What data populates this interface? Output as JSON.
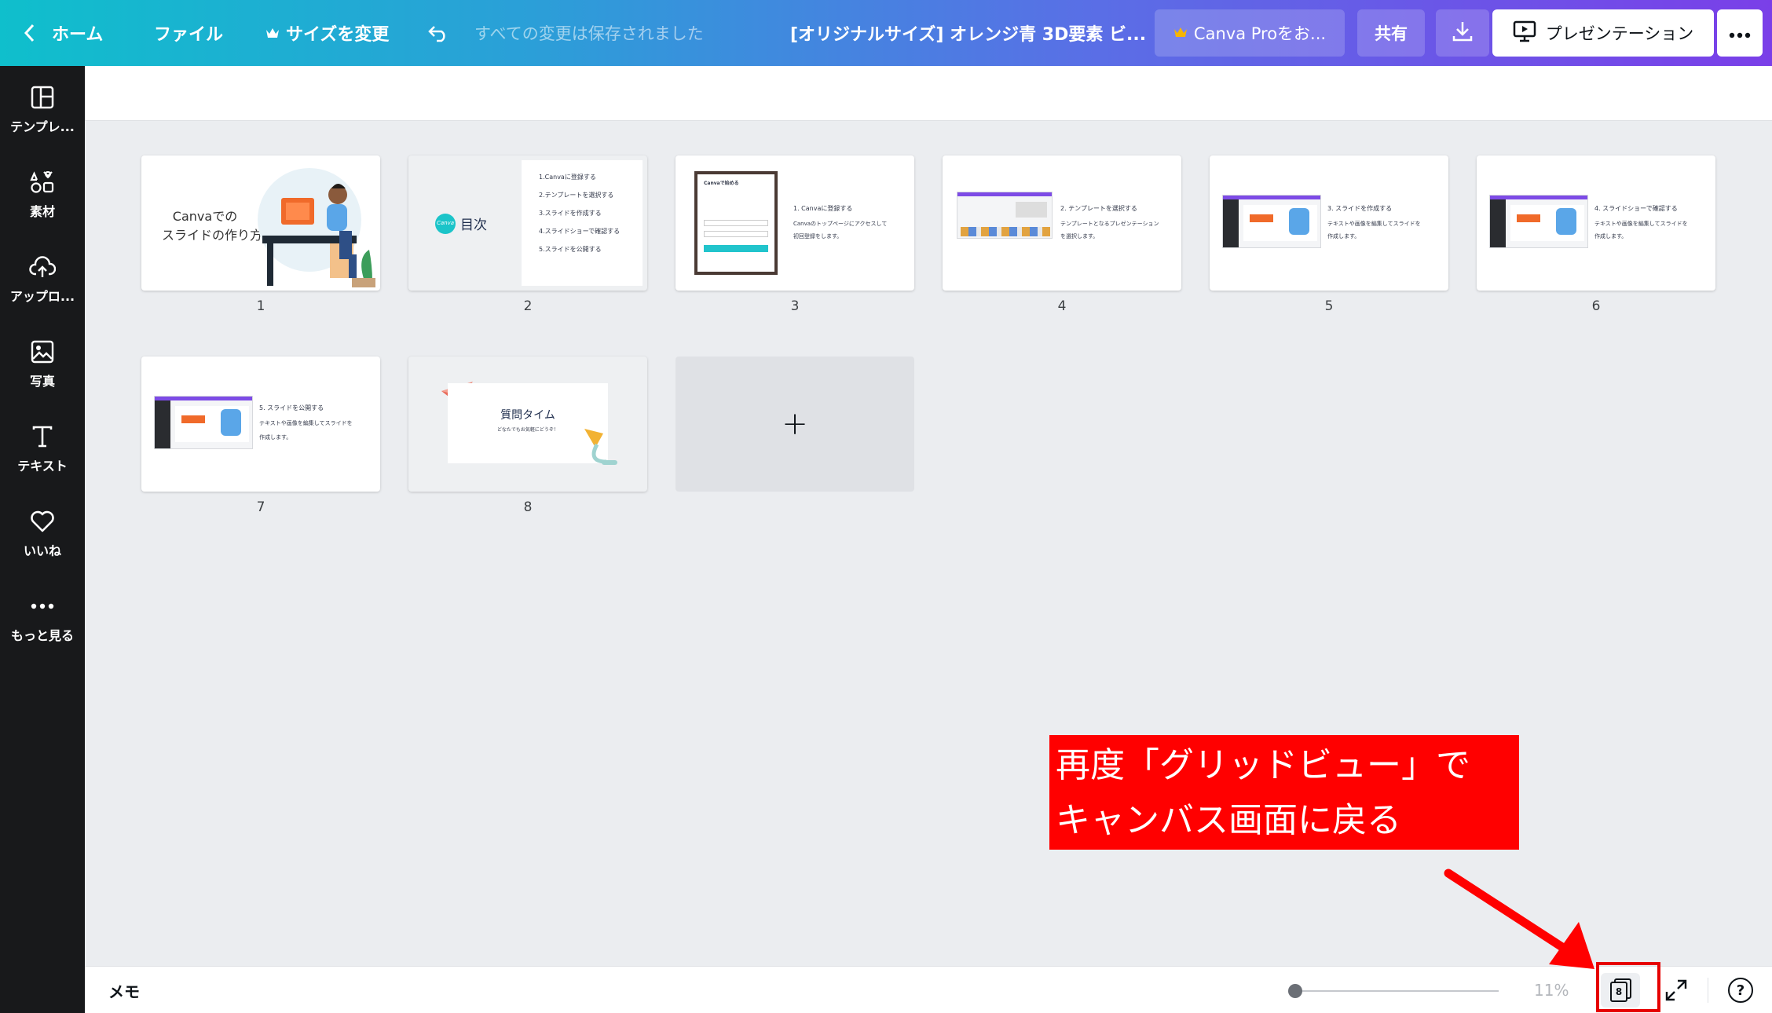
{
  "topbar": {
    "home": "ホーム",
    "file": "ファイル",
    "resize": "サイズを変更",
    "saved_status": "すべての変更は保存されました",
    "doc_title": "[オリジナルサイズ] オレンジ青 3D要素 ビ...",
    "pro_button": "Canva Proをお...",
    "share": "共有",
    "present": "プレゼンテーション"
  },
  "sidebar": {
    "items": [
      {
        "label": "テンプレ...",
        "icon": "template-icon"
      },
      {
        "label": "素材",
        "icon": "elements-icon"
      },
      {
        "label": "アップロ...",
        "icon": "upload-icon"
      },
      {
        "label": "写真",
        "icon": "photo-icon"
      },
      {
        "label": "テキスト",
        "icon": "text-icon"
      },
      {
        "label": "いいね",
        "icon": "heart-icon"
      },
      {
        "label": "もっと見る",
        "icon": "more-icon"
      }
    ]
  },
  "slides": [
    {
      "number": "1",
      "title_line1": "Canvaでの",
      "title_line2": "スライドの作り方"
    },
    {
      "number": "2",
      "logo_text": "Canva",
      "heading": "目次",
      "items": [
        "1.Canvaに登録する",
        "2.テンプレートを選択する",
        "3.スライドを作成する",
        "4.スライドショーで確認する",
        "5.スライドを公開する"
      ]
    },
    {
      "number": "3",
      "panel_title": "Canvaで始める",
      "heading": "1. Canvaに登録する",
      "body1": "Canvaのトップページにアクセスして",
      "body2": "初回登録をします。"
    },
    {
      "number": "4",
      "heading": "2. テンプレートを選択する",
      "body1": "テンプレートとなるプレゼンテーション",
      "body2": "を選択します。"
    },
    {
      "number": "5",
      "heading": "3. スライドを作成する",
      "body1": "テキストや画像を編集してスライドを",
      "body2": "作成します。"
    },
    {
      "number": "6",
      "heading": "4. スライドショーで確認する",
      "body1": "テキストや画像を編集してスライドを",
      "body2": "作成します。"
    },
    {
      "number": "7",
      "heading": "5. スライドを公開する",
      "body1": "テキストや画像を編集してスライドを",
      "body2": "作成します。"
    },
    {
      "number": "8",
      "heading": "質問タイム",
      "sub": "どなたでもお気軽にどうぞ！"
    }
  ],
  "add_page": "+",
  "bottombar": {
    "memo": "メモ",
    "zoom": "11%",
    "page_count": "8",
    "help": "?"
  },
  "annotation": {
    "line1": "再度「グリッドビュー」で",
    "line2": "キャンバス画面に戻る",
    "color": "#ff0000"
  },
  "colors": {
    "topbar_gradient_start": "#0fbfcc",
    "topbar_gradient_end": "#7a3fe8",
    "sidebar": "#18191b",
    "canvas_bg": "#ebedf0"
  }
}
